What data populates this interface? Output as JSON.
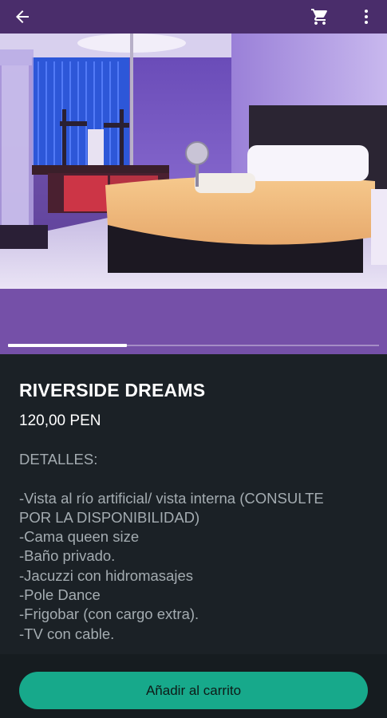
{
  "app_bar": {
    "back_icon": "arrow-left-icon",
    "cart_icon": "shopping-cart-icon",
    "more_icon": "more-vertical-icon",
    "background": "#4a2d6b"
  },
  "gallery": {
    "image": "hotel-room-photo",
    "image_count_indicator": {
      "active_fraction": 0.32
    }
  },
  "product": {
    "title": "RIVERSIDE DREAMS",
    "price": "120,00 PEN",
    "details_heading": "DETALLES:",
    "details_lines": [
      "-Vista al río artificial/ vista interna (CONSULTE",
      "POR LA DISPONIBILIDAD)",
      "-Cama queen size",
      "-Baño privado.",
      "-Jacuzzi con hidromasajes",
      "-Pole Dance",
      "-Frigobar (con cargo extra).",
      "-TV con cable."
    ]
  },
  "footer": {
    "add_to_cart_label": "Añadir al carrito",
    "accent": "#17a98b"
  }
}
